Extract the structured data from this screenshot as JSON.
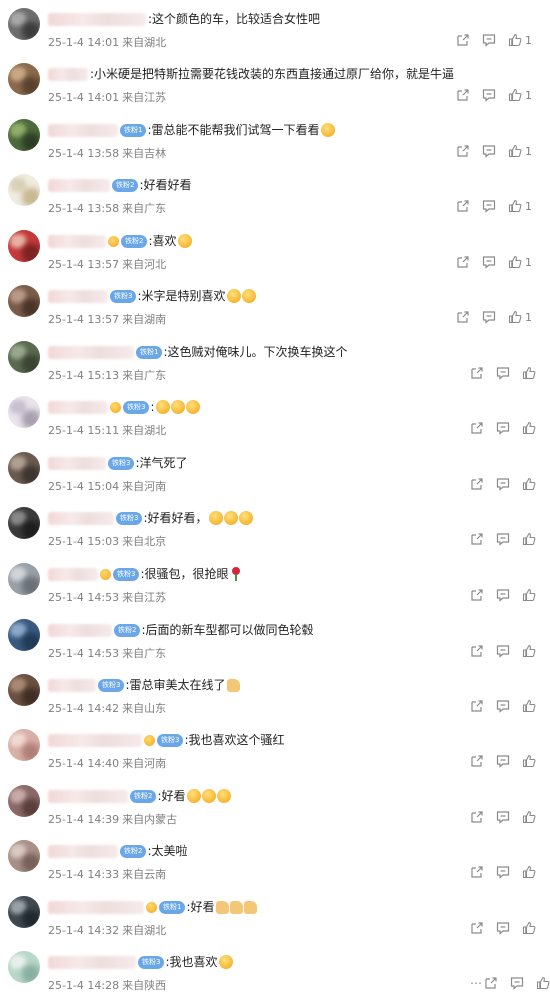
{
  "comments": [
    {
      "text": ":这个颜色的车，比较适合女性吧",
      "date": "25-1-4 14:01",
      "location": "来自湖北",
      "likes": "1",
      "badge": "",
      "name_w": 98,
      "avatar": [
        "#6e6e6e",
        "#a8a8a8",
        "#3c3c3c"
      ],
      "extra": ""
    },
    {
      "text": ":小米硬是把特斯拉需要花钱改装的东西直接通过原厂给你，就是牛逼",
      "date": "25-1-4 14:01",
      "location": "来自江苏",
      "likes": "1",
      "badge": "",
      "name_w": 40,
      "avatar": [
        "#8a6a4a",
        "#c9a884",
        "#5a4230"
      ],
      "extra": ""
    },
    {
      "text": ":雷总能不能帮我们试驾一下看看",
      "date": "25-1-4 13:58",
      "location": "来自吉林",
      "likes": "1",
      "badge": "铁粉1",
      "name_w": 70,
      "avatar": [
        "#4d6b3c",
        "#8fae6a",
        "#2e3e26"
      ],
      "extra": "emoji"
    },
    {
      "text": ":好看好看",
      "date": "25-1-4 13:58",
      "location": "来自广东",
      "likes": "1",
      "badge": "铁粉2",
      "name_w": 62,
      "avatar": [
        "#f0ece0",
        "#d9d0b8",
        "#c7b991"
      ],
      "extra": ""
    },
    {
      "text": ":喜欢",
      "date": "25-1-4 13:57",
      "location": "来自河北",
      "likes": "1",
      "badge": "铁粉2",
      "name_w": 58,
      "avatar": [
        "#c43a3a",
        "#e8b0a0",
        "#7a2222"
      ],
      "extra": "emoji"
    },
    {
      "text": ":米字是特别喜欢",
      "date": "25-1-4 13:57",
      "location": "来自湖南",
      "likes": "1",
      "badge": "铁粉3",
      "name_w": 60,
      "avatar": [
        "#7a5c4a",
        "#b89a86",
        "#4a3428"
      ],
      "extra": "emoji2"
    },
    {
      "text": ":这色贼对俺味儿。下次换车换这个",
      "date": "25-1-4 15:13",
      "location": "来自广东",
      "likes": "",
      "badge": "铁粉1",
      "name_w": 86,
      "avatar": [
        "#5a6a50",
        "#9aa88e",
        "#3a4432"
      ],
      "extra": ""
    },
    {
      "text": ":",
      "date": "25-1-4 15:11",
      "location": "来自湖北",
      "likes": "",
      "badge": "铁粉3",
      "name_w": 60,
      "avatar": [
        "#e8e4ea",
        "#c8c0d0",
        "#a8a0b0"
      ],
      "extra": "emoji3"
    },
    {
      "text": ":洋气死了",
      "date": "25-1-4 15:04",
      "location": "来自河南",
      "likes": "",
      "badge": "铁粉3",
      "name_w": 58,
      "avatar": [
        "#6a5a50",
        "#b0a090",
        "#3e3430"
      ],
      "extra": ""
    },
    {
      "text": ":好看好看，",
      "date": "25-1-4 15:03",
      "location": "来自北京",
      "likes": "",
      "badge": "铁粉3",
      "name_w": 66,
      "avatar": [
        "#3a3a3a",
        "#888888",
        "#1e1e1e"
      ],
      "extra": "emoji3"
    },
    {
      "text": ":很骚包，很抢眼",
      "date": "25-1-4 14:53",
      "location": "来自江苏",
      "likes": "",
      "badge": "铁粉3",
      "name_w": 50,
      "avatar": [
        "#9aa0a8",
        "#d0d4d8",
        "#6a7078"
      ],
      "extra": "rose"
    },
    {
      "text": ":后面的新车型都可以做同色轮毂",
      "date": "25-1-4 14:53",
      "location": "来自广东",
      "likes": "",
      "badge": "铁粉2",
      "name_w": 64,
      "avatar": [
        "#3a5a80",
        "#8aa8c8",
        "#203a58"
      ],
      "extra": ""
    },
    {
      "text": ":雷总审美太在线了",
      "date": "25-1-4 14:42",
      "location": "来自山东",
      "likes": "",
      "badge": "铁粉3",
      "name_w": 48,
      "avatar": [
        "#6a5040",
        "#a88a74",
        "#402e24"
      ],
      "extra": "thumb"
    },
    {
      "text": ":我也喜欢这个骚红",
      "date": "25-1-4 14:40",
      "location": "来自河南",
      "likes": "",
      "badge": "铁粉3",
      "name_w": 94,
      "avatar": [
        "#d8b0a8",
        "#f0d8d0",
        "#b08078"
      ],
      "extra": ""
    },
    {
      "text": ":好看",
      "date": "25-1-4 14:39",
      "location": "来自内蒙古",
      "likes": "",
      "badge": "铁粉2",
      "name_w": 80,
      "avatar": [
        "#8a6a68",
        "#c8aaa8",
        "#5a3e3c"
      ],
      "extra": "emoji3"
    },
    {
      "text": ":太美啦",
      "date": "25-1-4 14:33",
      "location": "来自云南",
      "likes": "",
      "badge": "铁粉2",
      "name_w": 70,
      "avatar": [
        "#a89088",
        "#d8c8c0",
        "#786058"
      ],
      "extra": ""
    },
    {
      "text": ":好看",
      "date": "25-1-4 14:32",
      "location": "来自湖北",
      "likes": "",
      "badge": "铁粉1",
      "name_w": 96,
      "avatar": [
        "#404850",
        "#98a0a8",
        "#202830"
      ],
      "extra": "thumb3"
    },
    {
      "text": ":我也喜欢",
      "date": "25-1-4 14:28",
      "location": "来自陕西",
      "likes": "",
      "badge": "铁粉3",
      "name_w": 88,
      "avatar": [
        "#b8d8c8",
        "#e8f0ec",
        "#88b0a0"
      ],
      "extra": "emoji"
    }
  ]
}
